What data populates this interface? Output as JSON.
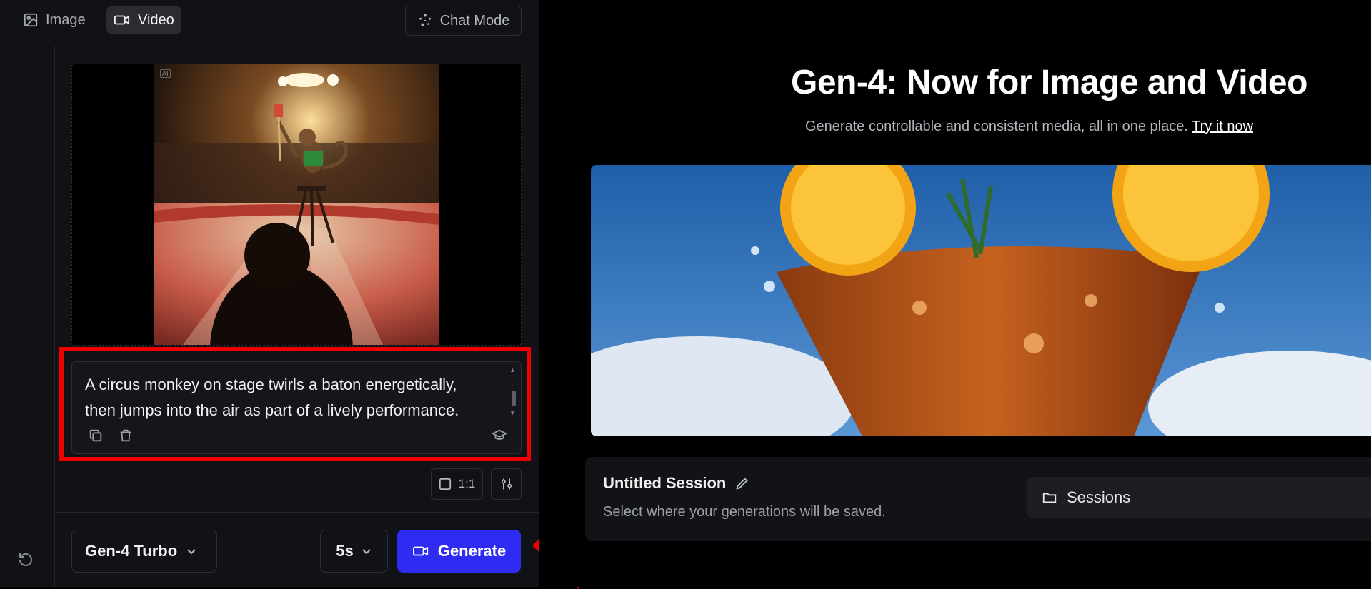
{
  "tabs": [
    {
      "label": "Image",
      "icon": "image-icon",
      "active": false
    },
    {
      "label": "Video",
      "icon": "video-icon",
      "active": true
    }
  ],
  "chat_mode": {
    "label": "Chat Mode",
    "icon": "sparkle-dots-icon"
  },
  "input_media": {
    "badge": "AI",
    "description_icon": "circus-monkey-image"
  },
  "prompt": {
    "text": "A circus monkey on stage twirls a baton energetically, then jumps into the air as part of a lively performance."
  },
  "aspect_ratio": {
    "label": "1:1"
  },
  "model": {
    "label": "Gen-4 Turbo"
  },
  "duration": {
    "label": "5s"
  },
  "generate": {
    "label": "Generate"
  },
  "hero": {
    "title": "Gen-4: Now for Image and Video",
    "subtitle": "Generate controllable and consistent media, all in one place.",
    "link": "Try it now"
  },
  "session": {
    "title": "Untitled Session",
    "subtitle": "Select where your generations will be saved.",
    "sessions_label": "Sessions"
  },
  "colors": {
    "accent": "#2e2cf2",
    "highlight": "#f00000",
    "panel": "#111215"
  }
}
